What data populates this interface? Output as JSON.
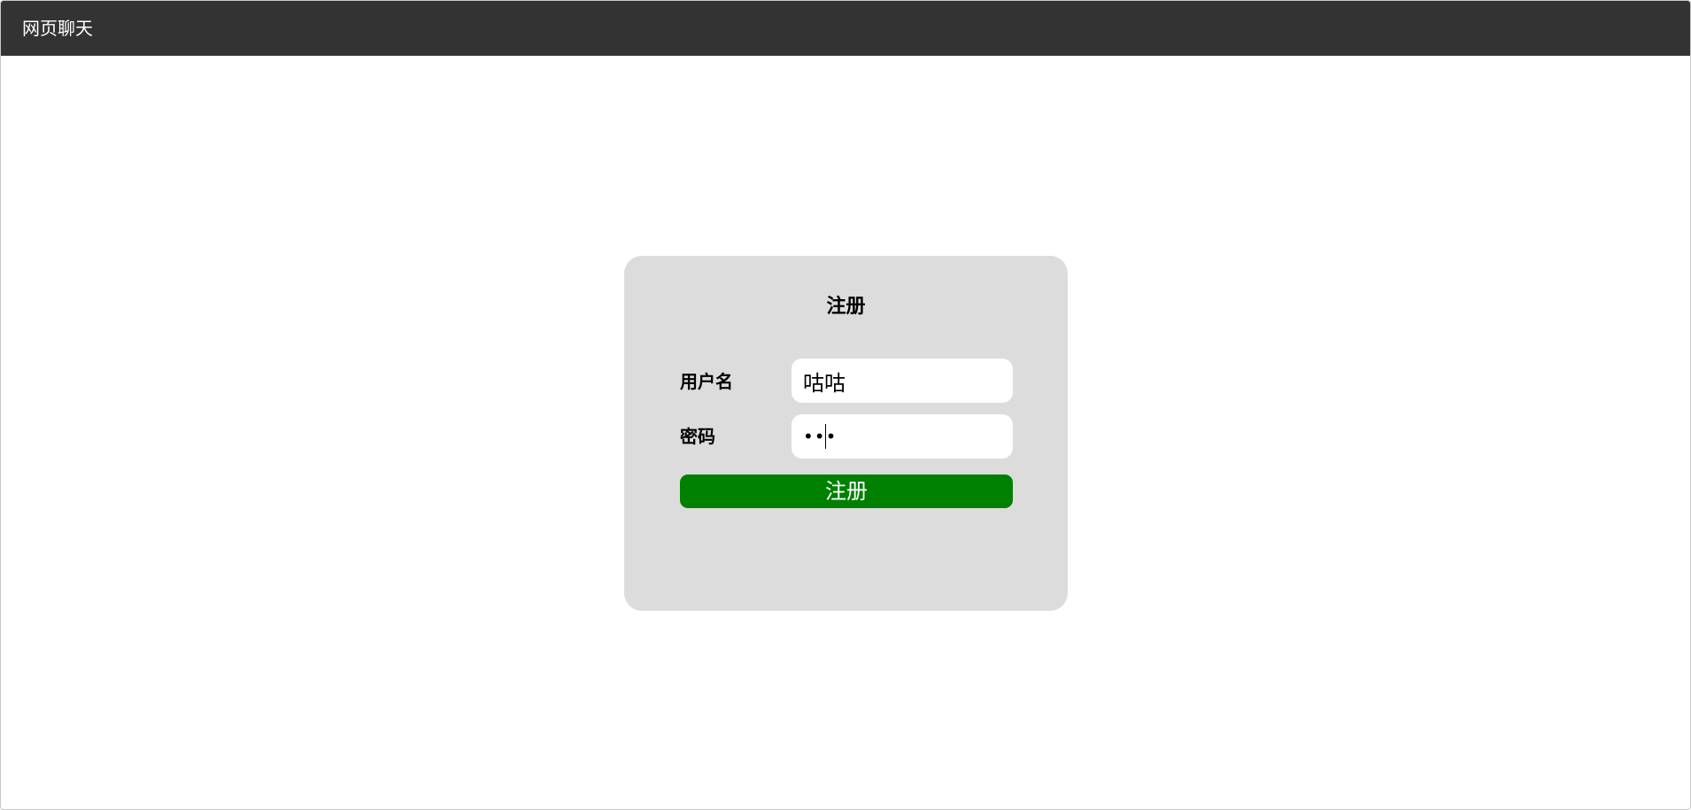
{
  "app": {
    "title": "网页聊天"
  },
  "register_form": {
    "heading": "注册",
    "username": {
      "label": "用户名",
      "value": "咕咕"
    },
    "password": {
      "label": "密码",
      "value": "•••"
    },
    "submit_label": "注册"
  },
  "colors": {
    "titlebar": "#333333",
    "card_background": "#dcdcdc",
    "submit_button": "#008000",
    "input_background": "#ffffff"
  }
}
